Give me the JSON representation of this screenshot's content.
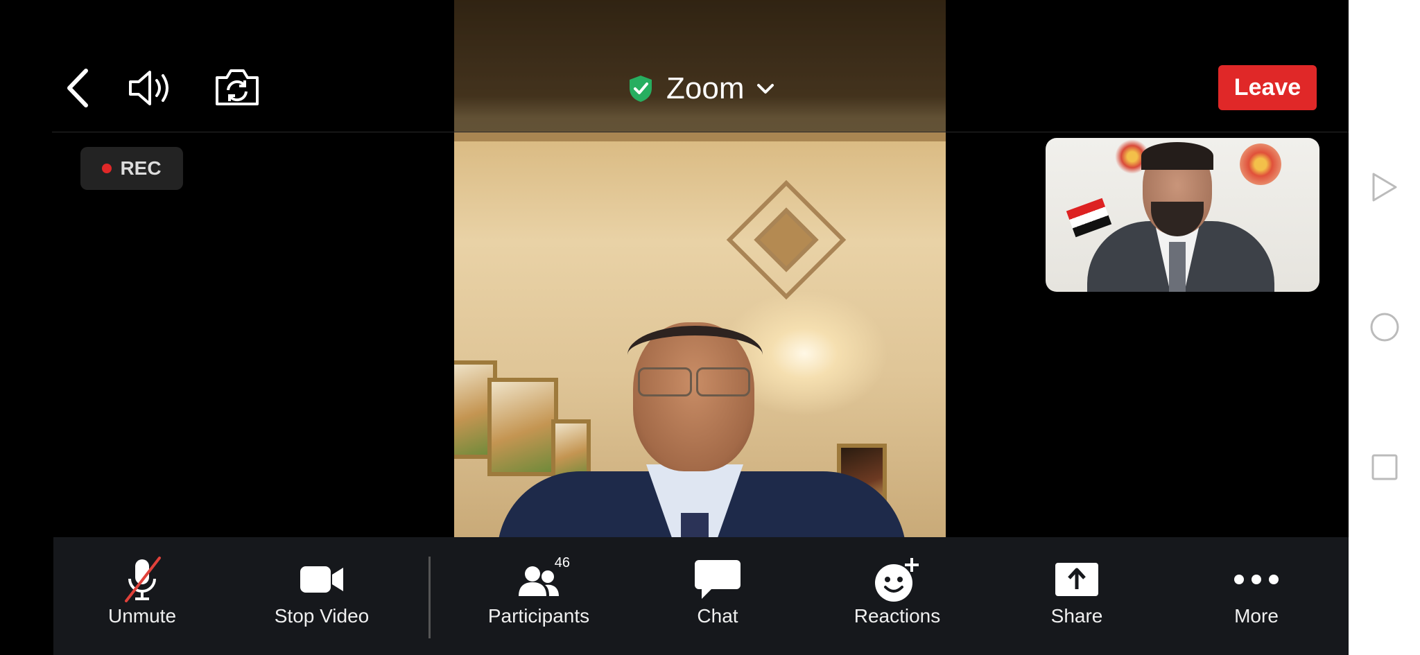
{
  "header": {
    "title": "Zoom",
    "leave_label": "Leave"
  },
  "recording": {
    "label": "REC"
  },
  "toolbar": {
    "items": [
      {
        "label": "Unmute",
        "icon": "mic-muted-icon"
      },
      {
        "label": "Stop Video",
        "icon": "video-camera-icon"
      },
      {
        "label": "Participants",
        "icon": "participants-icon",
        "badge": "46"
      },
      {
        "label": "Chat",
        "icon": "chat-bubble-icon"
      },
      {
        "label": "Reactions",
        "icon": "reactions-smiley-icon"
      },
      {
        "label": "Share",
        "icon": "share-upload-icon"
      },
      {
        "label": "More",
        "icon": "more-dots-icon"
      }
    ]
  },
  "colors": {
    "leave": "#e02828",
    "shield": "#27ae60",
    "toolbar_bg": "#16181c",
    "mute_slash": "#e0413a"
  },
  "android_nav": {
    "icons": [
      "back-triangle-icon",
      "home-circle-icon",
      "recents-square-icon"
    ]
  }
}
